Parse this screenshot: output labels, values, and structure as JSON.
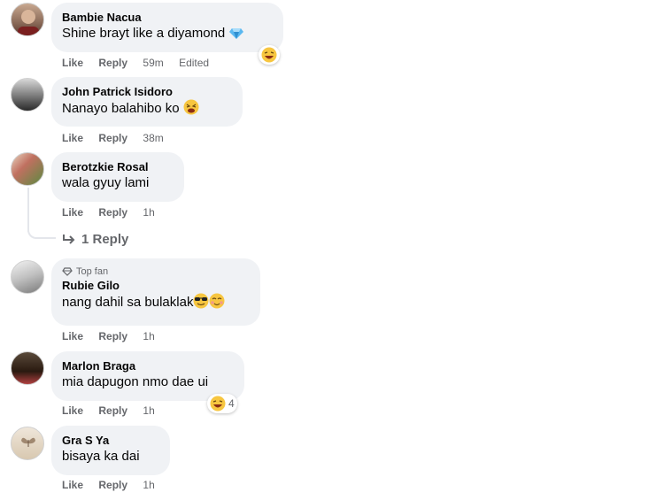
{
  "comments": [
    {
      "author": "Bambie Nacua",
      "text": "Shine brayt like a diyamond",
      "like": "Like",
      "reply": "Reply",
      "time": "59m",
      "edited": "Edited"
    },
    {
      "author": "John Patrick Isidoro",
      "text": "Nanayo balahibo ko",
      "like": "Like",
      "reply": "Reply",
      "time": "38m"
    },
    {
      "author": "Berotzkie Rosal",
      "text": "wala gyuy lami",
      "like": "Like",
      "reply": "Reply",
      "time": "1h",
      "replies": "1 Reply"
    },
    {
      "author": "Rubie Gilo",
      "badge": "Top fan",
      "text": "nang dahil sa bulaklak",
      "like": "Like",
      "reply": "Reply",
      "time": "1h"
    },
    {
      "author": "Marlon Braga",
      "text": "mia dapugon nmo dae ui",
      "like": "Like",
      "reply": "Reply",
      "time": "1h",
      "reaction_count": "4"
    },
    {
      "author": "Gra S Ya",
      "text": "bisaya ka dai",
      "like": "Like",
      "reply": "Reply",
      "time": "1h"
    }
  ],
  "colors": {
    "bubble": "#f0f2f5",
    "meta": "#65676b",
    "text": "#050505"
  },
  "icons": [
    "diamond-icon",
    "laughing-emoji-icon",
    "tired-face-emoji-icon",
    "sunglasses-emoji-icon",
    "blushing-emoji-icon",
    "reply-arrow-icon"
  ]
}
